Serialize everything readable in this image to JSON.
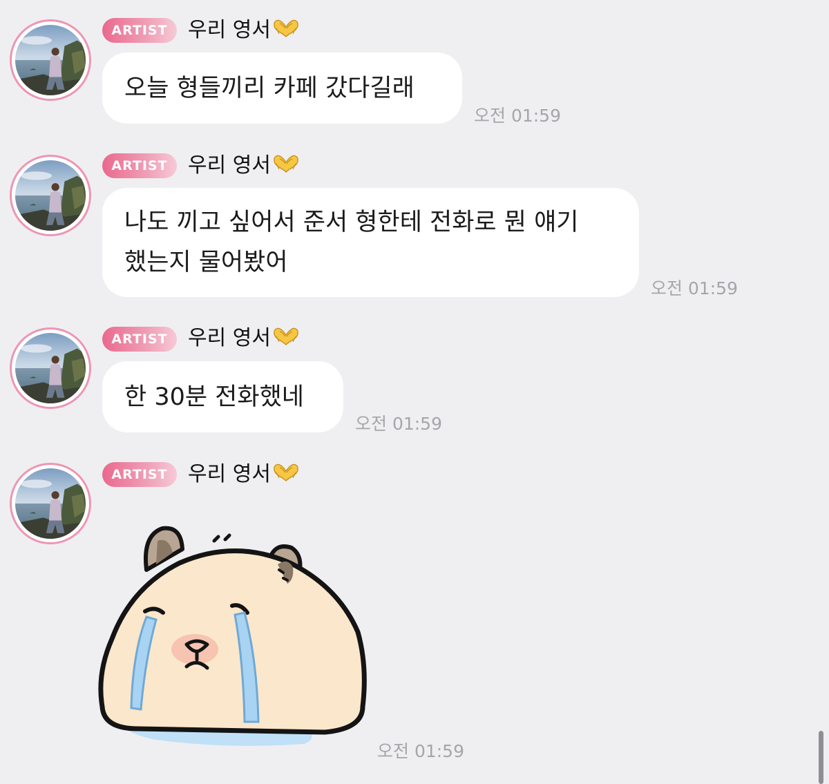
{
  "messages": [
    {
      "badge": "ARTIST",
      "sender": "우리 영서",
      "text": "오늘 형들끼리 카페 갔다길래",
      "time": "오전 01:59"
    },
    {
      "badge": "ARTIST",
      "sender": "우리 영서",
      "text": "나도 끼고 싶어서 준서 형한테 전화로 뭔 얘기\n했는지 물어봤어",
      "time": "오전 01:59"
    },
    {
      "badge": "ARTIST",
      "sender": "우리 영서",
      "text": "한 30분 전화했네",
      "time": "오전 01:59"
    },
    {
      "badge": "ARTIST",
      "sender": "우리 영서",
      "sticker": "crying-capybara-sticker",
      "time": "오전 01:59"
    }
  ],
  "icons": {
    "sender_emoji": "heart-hands-icon",
    "avatar": "avatar-photo-seaside"
  },
  "colors": {
    "background": "#efeff1",
    "badge_start": "#e9698e",
    "badge_end": "#f7c9d6",
    "avatar_ring": "#ee95b3",
    "bubble": "#ffffff",
    "timestamp": "#a6a6aa"
  }
}
